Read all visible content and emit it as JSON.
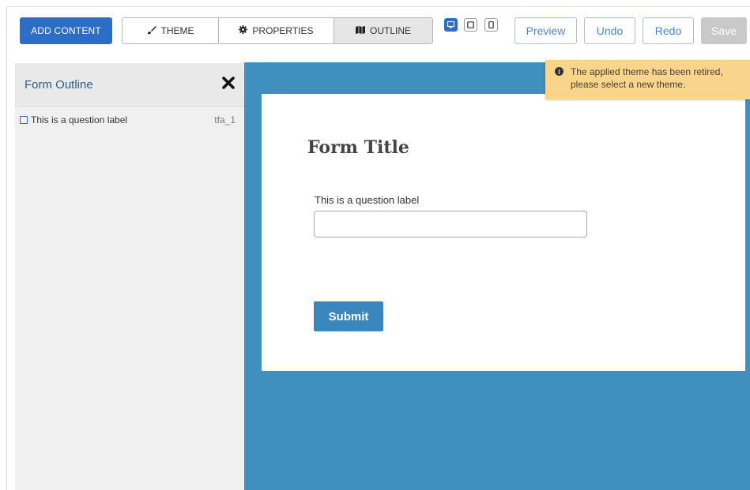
{
  "toolbar": {
    "add_content": "ADD CONTENT",
    "tabs": [
      {
        "label": "THEME",
        "icon": "brush-icon"
      },
      {
        "label": "PROPERTIES",
        "icon": "gear-icon"
      },
      {
        "label": "OUTLINE",
        "icon": "map-icon",
        "active": true
      }
    ],
    "devices": [
      {
        "name": "desktop",
        "active": true
      },
      {
        "name": "tablet",
        "active": false
      },
      {
        "name": "phone",
        "active": false
      }
    ],
    "preview": "Preview",
    "undo": "Undo",
    "redo": "Redo",
    "save": "Save"
  },
  "sidebar": {
    "title": "Form Outline",
    "items": [
      {
        "label": "This is a question label",
        "id": "tfa_1"
      }
    ]
  },
  "form": {
    "title": "Form Title",
    "question_label": "This is a question label",
    "input_value": "",
    "submit_label": "Submit"
  },
  "notice": {
    "text": "The applied theme has been retired, please select a new theme."
  },
  "colors": {
    "accent": "#2c6dc6",
    "canvas_bg": "#3f8fbf",
    "submit_bg": "#3a87bd",
    "notice_bg": "#f8d58b",
    "save_disabled": "#c9c9c9"
  }
}
